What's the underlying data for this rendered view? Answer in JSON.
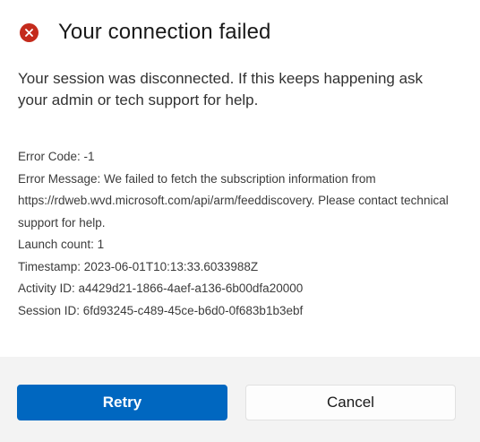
{
  "dialog": {
    "title": "Your connection failed",
    "message": "Your session was disconnected. If this keeps happening ask your admin or tech support for help.",
    "icon": "error-icon",
    "accent_color": "#c42b1c"
  },
  "details": {
    "error_code": "Error Code: -1",
    "error_message": "Error Message: We failed to fetch the subscription information from https://rdweb.wvd.microsoft.com/api/arm/feeddiscovery. Please contact technical support for help.",
    "launch_count": "Launch count: 1",
    "timestamp": "Timestamp: 2023-06-01T10:13:33.6033988Z",
    "activity_id": "Activity ID: a4429d21-1866-4aef-a136-6b00dfa20000",
    "session_id": "Session ID: 6fd93245-c489-45ce-b6d0-0f683b1b3ebf"
  },
  "buttons": {
    "retry_label": "Retry",
    "cancel_label": "Cancel",
    "primary_color": "#0067c0"
  }
}
